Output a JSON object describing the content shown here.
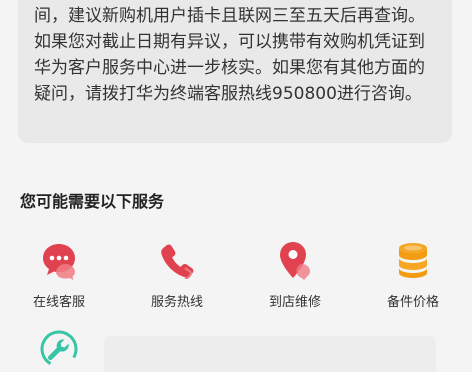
{
  "notice": {
    "text": "间，建议新购机用户插卡且联网三至五天后再查询。如果您对截止日期有异议，可以携带有效购机凭证到华为客户服务中心进一步核实。如果您有其他方面的疑问，请拨打华为终端客服热线950800进行咨询。"
  },
  "services_section": {
    "title": "您可能需要以下服务",
    "items": [
      {
        "label": "在线客服",
        "icon": "chat-bubble-icon"
      },
      {
        "label": "服务热线",
        "icon": "phone-icon"
      },
      {
        "label": "到店维修",
        "icon": "location-pin-icon"
      },
      {
        "label": "备件价格",
        "icon": "coin-stack-icon"
      }
    ],
    "more_item": {
      "label": "",
      "icon": "wrench-icon"
    }
  },
  "colors": {
    "accent_red": "#e0434f",
    "accent_orange": "#f5a623",
    "accent_teal": "#37c4a7",
    "card_bg": "#e9e9e9",
    "page_bg": "#f4f4f4"
  }
}
